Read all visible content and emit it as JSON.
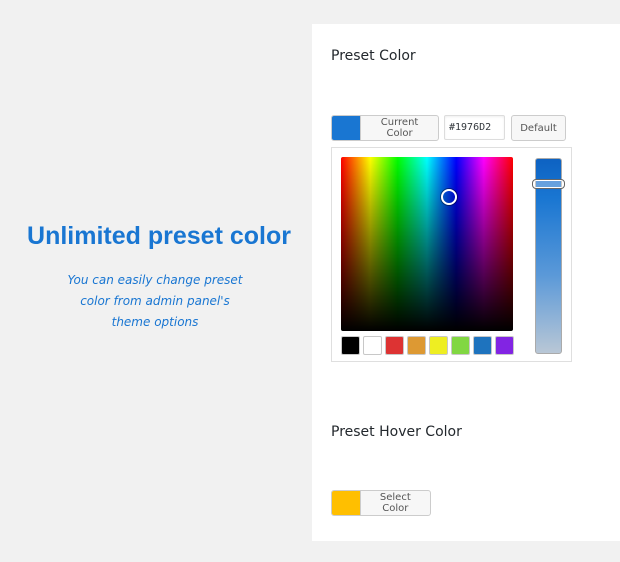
{
  "promo": {
    "title": "Unlimited preset color",
    "subtitle_line1": "You can easily change preset",
    "subtitle_line2": "color from admin panel's",
    "subtitle_line3": "theme options"
  },
  "preset_color": {
    "label": "Preset Color",
    "button_label": "Current Color",
    "swatch_color": "#1976D2",
    "hex_value": "#1976D2",
    "default_label": "Default",
    "palette": [
      "#000000",
      "#ffffff",
      "#dd3333",
      "#dd9933",
      "#eeee22",
      "#81d742",
      "#1e73be",
      "#8224e3"
    ]
  },
  "preset_hover_color": {
    "label": "Preset Hover Color",
    "button_label": "Select Color",
    "swatch_color": "#FFBF00"
  }
}
